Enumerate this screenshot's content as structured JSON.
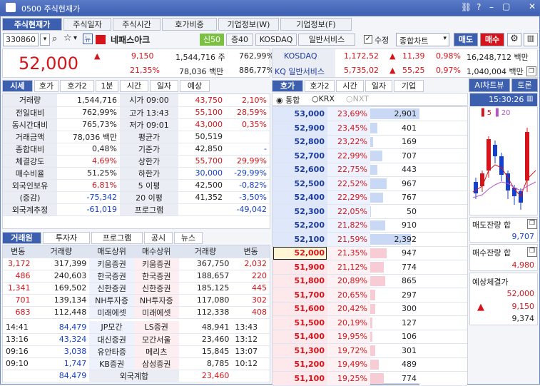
{
  "window": {
    "title": "0500 주식현재가",
    "icons": [
      "link-icon",
      "help-icon",
      "minimize-icon",
      "maximize-icon",
      "close-icon"
    ]
  },
  "tabs": [
    {
      "label": "주식현재가",
      "active": true
    },
    {
      "label": "주식일자"
    },
    {
      "label": "주식시간"
    },
    {
      "label": "호가비중"
    },
    {
      "label": "기업정보(W)"
    },
    {
      "label": "기업정보(F)"
    }
  ],
  "stock": {
    "code": "330860",
    "name": "네패스아크",
    "badge_credit": "신50",
    "badge_margin": "증40",
    "market": "KOSDAQ",
    "sector": "일반서비스",
    "edit_label": "수정",
    "chart_select": "종합차트",
    "sell_label": "매도",
    "buy_label": "매수"
  },
  "quote": {
    "price": "52,000",
    "change": "9,150",
    "change_pct": "21,35%",
    "volume": "1,544,716 주",
    "volume_ratio": "762,99%",
    "amount": "78,036 백만",
    "amount_ratio": "886,77%"
  },
  "index": [
    {
      "name": "KOSDAQ",
      "value": "1,172,52",
      "change": "11,39",
      "pct": "0,98%",
      "vol": "16,248,712 백만"
    },
    {
      "name": "KQ 일반서비스",
      "value": "5,735,02",
      "change": "55,25",
      "pct": "0,97%",
      "vol": "1,040,004 백만"
    }
  ],
  "left_tabs": [
    "시세",
    "호가",
    "호가2",
    "1분",
    "시간",
    "일자",
    "예상"
  ],
  "stats": [
    {
      "l": "거래량",
      "v": "1,544,716",
      "l2": "시가 09:00",
      "v2a": "43,750",
      "v2b": "2,10%"
    },
    {
      "l": "전일대비",
      "v": "762,99%",
      "l2": "고가 13:43",
      "v2a": "55,100",
      "v2b": "28,59%"
    },
    {
      "l": "동시간대비",
      "v": "765,73%",
      "l2": "저가 09:01",
      "v2a": "43,000",
      "v2b": "0,35%"
    },
    {
      "l": "거래금액",
      "v": "78,036 백만",
      "l2": "평균가",
      "v2a": "50,519",
      "v2b": ""
    },
    {
      "l": "종합대비",
      "v": "0,48%",
      "l2": "기준가",
      "v2a": "42,850",
      "v2b": "-"
    },
    {
      "l": "체결강도",
      "v": "4,69%",
      "l2": "상한가",
      "v2a": "55,700",
      "v2b": "29,99%"
    },
    {
      "l": "매수비율",
      "v": "51,25%",
      "l2": "하한가",
      "v2a": "30,000",
      "v2b": "-29,99%"
    },
    {
      "l": "외국인보유",
      "v": "6,81%",
      "l2": "5 이평",
      "v2a": "42,500",
      "v2b": "-0,82%"
    },
    {
      "l": "(증감)",
      "v": "-75,342",
      "l2": "20 이평",
      "v2a": "41,352",
      "v2b": "-3,50%"
    },
    {
      "l": "외국계추정",
      "v": "-61,019",
      "l2": "프로그램",
      "v2a": "",
      "v2b": "-49,042"
    }
  ],
  "broker_tabs": [
    "거래원",
    "투자자",
    "프로그램",
    "공시",
    "뉴스"
  ],
  "broker_header": [
    "변동",
    "거래량",
    "매도상위",
    "매수상위",
    "거래량",
    "변동"
  ],
  "brokers": [
    {
      "c1": "3,172",
      "c2": "317,399",
      "s": "키움증권",
      "b": "키움증권",
      "c5": "367,750",
      "c6": "2,032"
    },
    {
      "c1": "486",
      "c2": "240,603",
      "s": "한국증권",
      "b": "한국증권",
      "c5": "188,657",
      "c6": "220"
    },
    {
      "c1": "1,341",
      "c2": "169,502",
      "s": "신한증권",
      "b": "신한증권",
      "c5": "185,125",
      "c6": "445"
    },
    {
      "c1": "701",
      "c2": "139,134",
      "s": "NH투자증",
      "b": "NH투자증",
      "c5": "117,080",
      "c6": "302"
    },
    {
      "c1": "683",
      "c2": "112,448",
      "s": "미래에셋",
      "b": "미래에셋",
      "c5": "112,338",
      "c6": "408"
    }
  ],
  "foreign": [
    {
      "t": "14:41",
      "v": "84,479",
      "s": "JP모간",
      "b": "LS증권",
      "v2": "48,941",
      "t2": "13:43"
    },
    {
      "t": "13:16",
      "v": "43,324",
      "s": "대신증권",
      "b": "모간서울",
      "v2": "23,460",
      "t2": "13:12"
    },
    {
      "t": "09:16",
      "v": "3,038",
      "s": "유안타증",
      "b": "메리츠",
      "v2": "15,845",
      "t2": "13:07"
    },
    {
      "t": "09:10",
      "v": "1,747",
      "s": "KB증권",
      "b": "삼성증권",
      "v2": "8,785",
      "t2": "10:12"
    }
  ],
  "foreign_total": {
    "label": "외국계합",
    "sell": "84,479",
    "buy": "23,460"
  },
  "ob_tabs": [
    "호가",
    "호가2",
    "시간",
    "일자",
    "기업"
  ],
  "exchanges": [
    "통합",
    "KRX",
    "NXT"
  ],
  "asks": [
    {
      "p": "53,000",
      "pct": "23,69%",
      "v": "2,901",
      "f": 1.0
    },
    {
      "p": "52,900",
      "pct": "23,45%",
      "v": "401",
      "f": 0.14
    },
    {
      "p": "52,800",
      "pct": "23,22%",
      "v": "169",
      "f": 0.06
    },
    {
      "p": "52,700",
      "pct": "22,99%",
      "v": "707",
      "f": 0.24
    },
    {
      "p": "52,600",
      "pct": "22,75%",
      "v": "443",
      "f": 0.15
    },
    {
      "p": "52,500",
      "pct": "22,52%",
      "v": "967",
      "f": 0.33
    },
    {
      "p": "52,400",
      "pct": "22,29%",
      "v": "767",
      "f": 0.26
    },
    {
      "p": "52,300",
      "pct": "22,05%",
      "v": "50",
      "f": 0.02
    },
    {
      "p": "52,200",
      "pct": "21,82%",
      "v": "910",
      "f": 0.31
    },
    {
      "p": "52,100",
      "pct": "21,59%",
      "v": "2,392",
      "f": 0.82
    }
  ],
  "bids": [
    {
      "p": "52,000",
      "pct": "21,35%",
      "v": "947",
      "f": 0.33
    },
    {
      "p": "51,900",
      "pct": "21,12%",
      "v": "774",
      "f": 0.27
    },
    {
      "p": "51,800",
      "pct": "20,89%",
      "v": "865",
      "f": 0.3
    },
    {
      "p": "51,700",
      "pct": "20,65%",
      "v": "297",
      "f": 0.1
    },
    {
      "p": "51,600",
      "pct": "20,42%",
      "v": "300",
      "f": 0.1
    },
    {
      "p": "51,500",
      "pct": "20,19%",
      "v": "127",
      "f": 0.04
    },
    {
      "p": "51,400",
      "pct": "19,95%",
      "v": "106",
      "f": 0.04
    },
    {
      "p": "51,300",
      "pct": "19,72%",
      "v": "301",
      "f": 0.1
    },
    {
      "p": "51,200",
      "pct": "19,49%",
      "v": "489",
      "f": 0.17
    },
    {
      "p": "51,100",
      "pct": "19,25%",
      "v": "774",
      "f": 0.27
    }
  ],
  "side": {
    "ai_label": "AI차트뷰",
    "talk_label": "토론",
    "time": "15:30:26",
    "ma5": "5",
    "ma20": "20",
    "ask_rem_label": "매도잔량 합",
    "ask_rem": "9,707",
    "bid_rem_label": "매수잔량 합",
    "bid_rem": "4,980",
    "exp_label": "예상체결가",
    "exp_price": "52,000",
    "exp_change": "9,150",
    "exp_vol": "9,374"
  },
  "colors": {
    "up": "#d4141a",
    "down": "#1440cc",
    "accent": "#3c5fb0"
  }
}
